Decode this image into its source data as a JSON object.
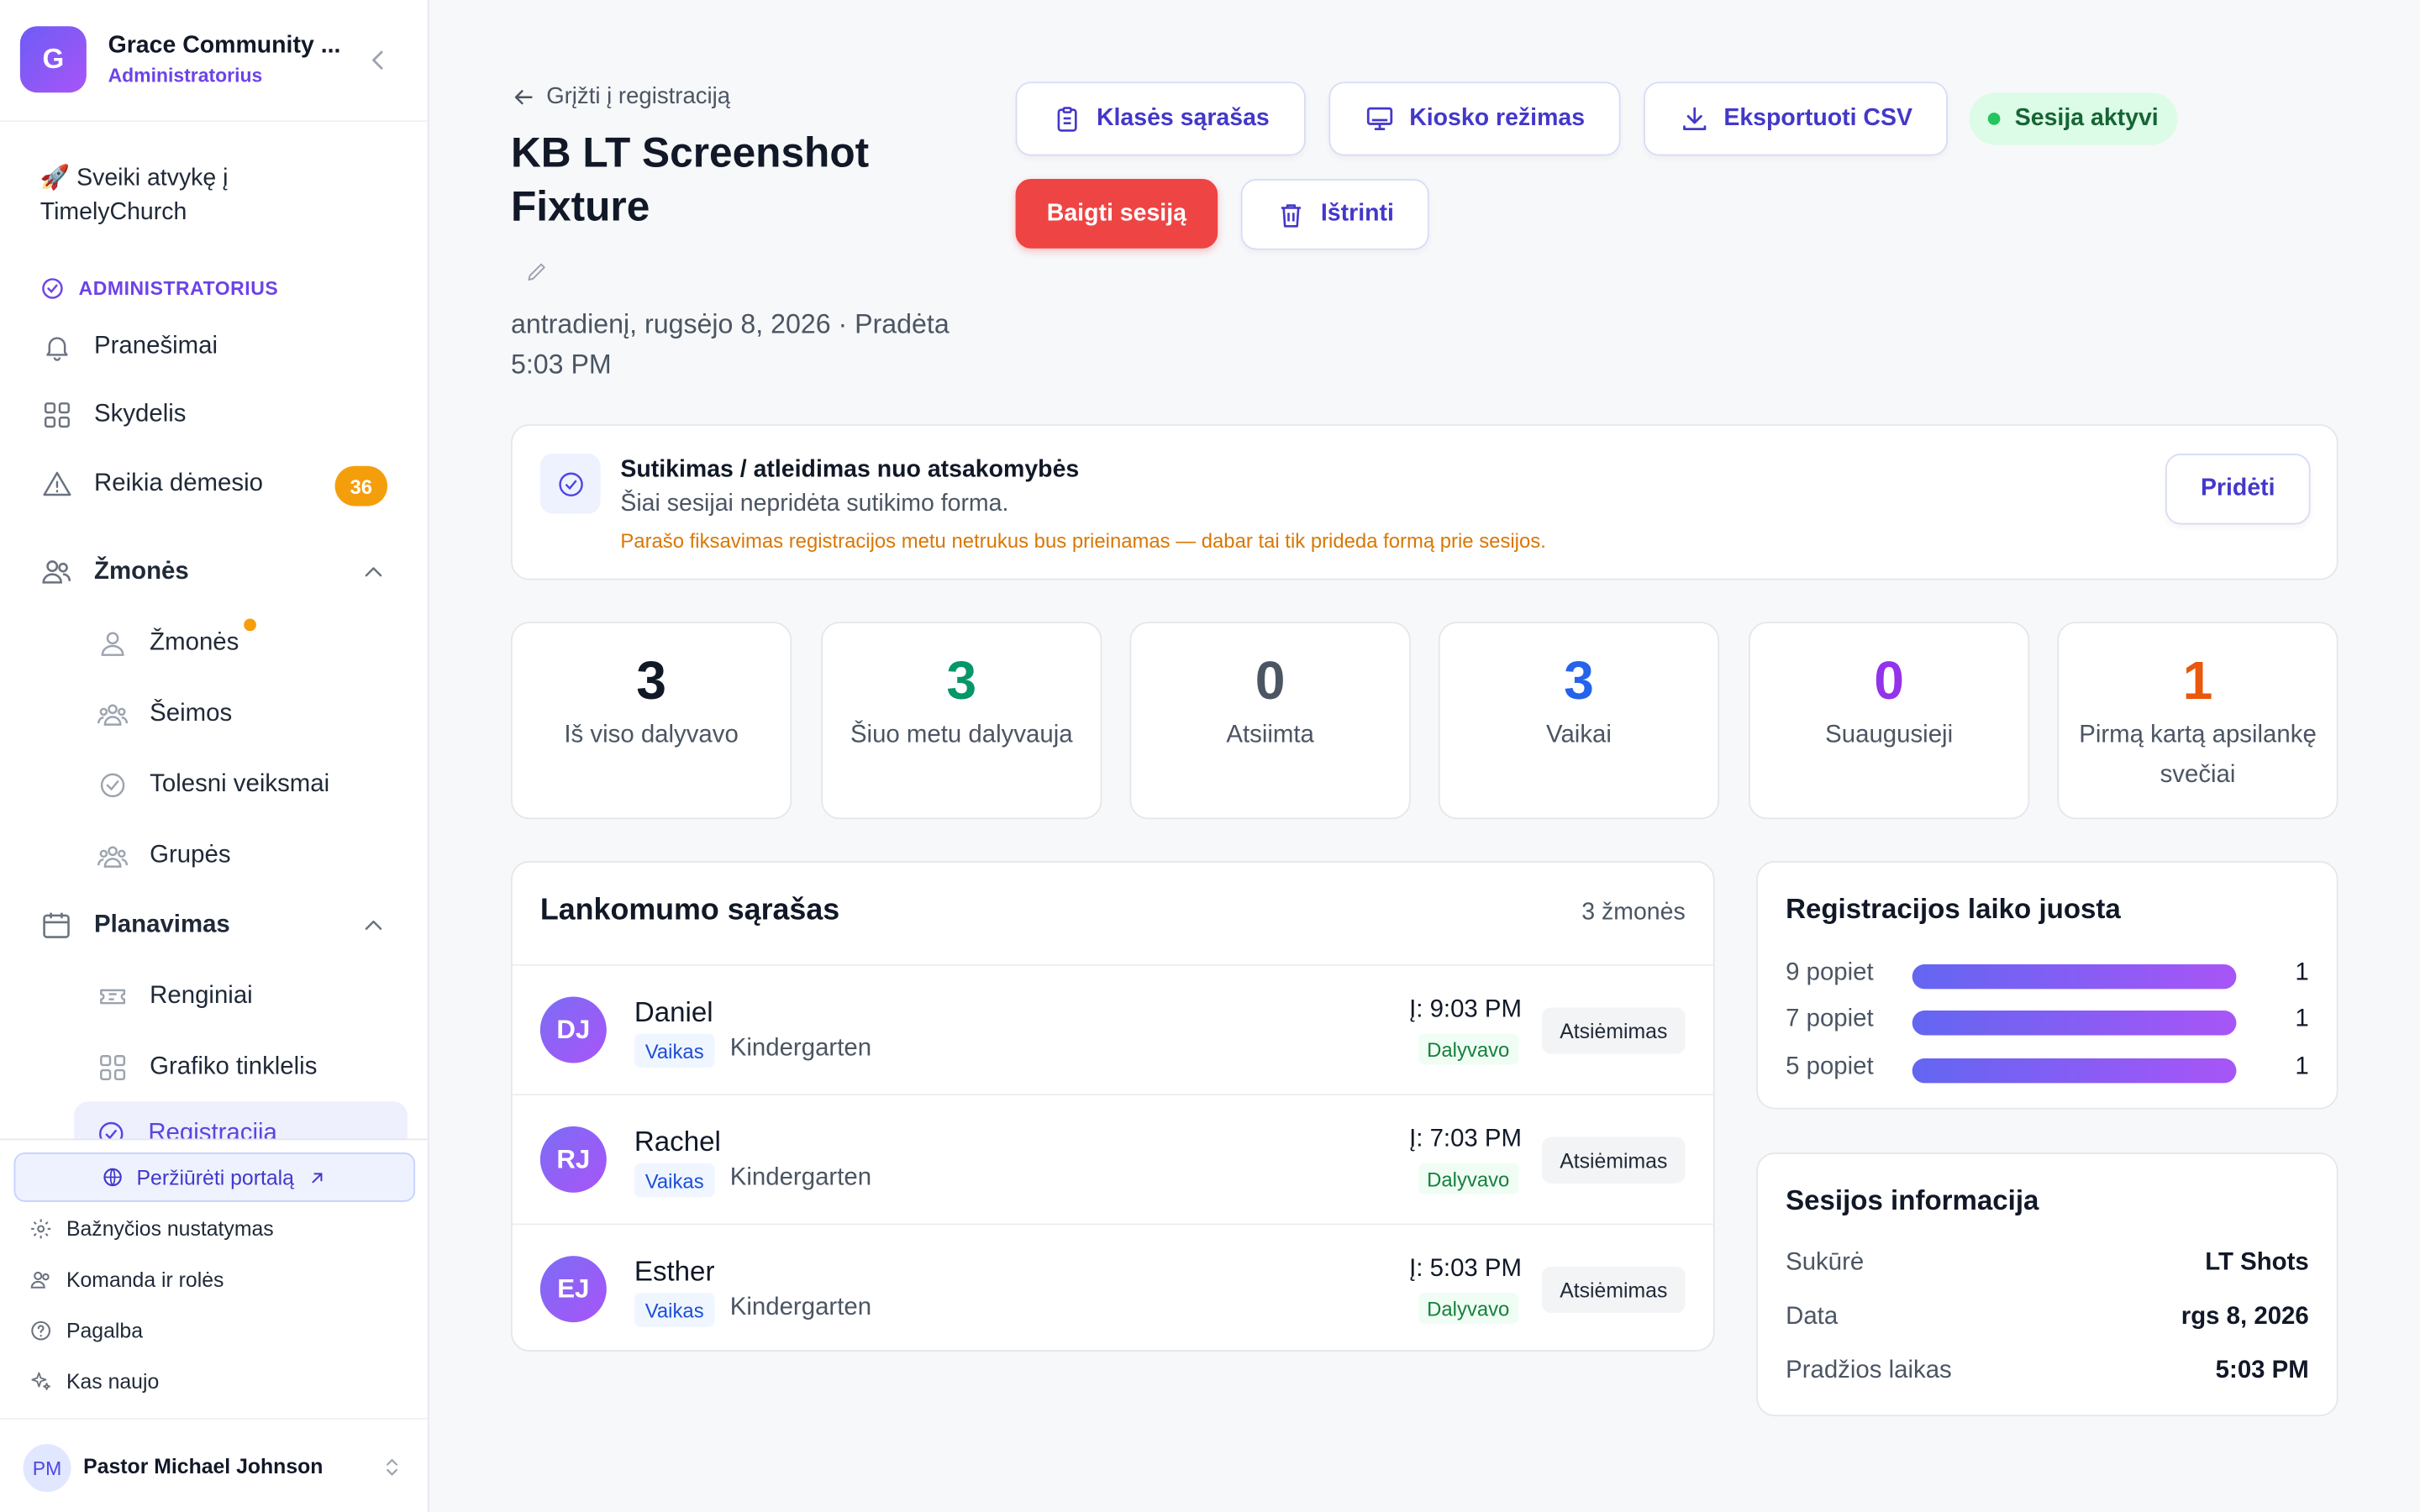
{
  "sidebar": {
    "org_initial": "G",
    "org_name": "Grace Community ...",
    "org_role": "Administratorius",
    "welcome": "🚀 Sveiki atvykę į TimelyChurch",
    "admin_section": "ADMINISTRATORIUS",
    "items": {
      "notifications": "Pranešimai",
      "dashboard": "Skydelis",
      "attention": "Reikia dėmesio",
      "attention_count": "36",
      "people_group": "Žmonės",
      "people": "Žmonės",
      "families": "Šeimos",
      "followups": "Tolesni veiksmai",
      "groups": "Grupės",
      "planning_group": "Planavimas",
      "events": "Renginiai",
      "schedule_grid": "Grafiko tinklelis",
      "checkin": "Registracija"
    },
    "footer": {
      "portal": "Peržiūrėti portalą",
      "church_settings": "Bažnyčios nustatymas",
      "team_roles": "Komanda ir rolės",
      "help": "Pagalba",
      "whats_new": "Kas naujo",
      "user_initials": "PM",
      "user_name": "Pastor Michael Johnson"
    }
  },
  "header": {
    "back": "Grįžti į registraciją",
    "title": "KB LT Screenshot Fixture",
    "subtitle": "antradienį, rugsėjo 8, 2026 · Pradėta 5:03 PM",
    "buttons": {
      "class_list": "Klasės sąrašas",
      "kiosk": "Kiosko režimas",
      "export": "Eksportuoti CSV",
      "end_session": "Baigti sesiją",
      "delete": "Ištrinti"
    },
    "status": "Sesija aktyvi"
  },
  "consent": {
    "title": "Sutikimas / atleidimas nuo atsakomybės",
    "subtitle": "Šiai sesijai nepridėta sutikimo forma.",
    "note": "Parašo fiksavimas registracijos metu netrukus bus prieinamas — dabar tai tik prideda formą prie sesijos.",
    "add": "Pridėti"
  },
  "stats": [
    {
      "value": "3",
      "label": "Iš viso dalyvavo",
      "color": "#111827"
    },
    {
      "value": "3",
      "label": "Šiuo metu dalyvauja",
      "color": "#059669"
    },
    {
      "value": "0",
      "label": "Atsiimta",
      "color": "#4b5563"
    },
    {
      "value": "3",
      "label": "Vaikai",
      "color": "#2563eb"
    },
    {
      "value": "0",
      "label": "Suaugusieji",
      "color": "#9333ea"
    },
    {
      "value": "1",
      "label": "Pirmą kartą apsilankę svečiai",
      "color": "#ea580c"
    }
  ],
  "attendance": {
    "title": "Lankomumo sąrašas",
    "count": "3 žmonės",
    "rows": [
      {
        "initials": "DJ",
        "name": "Daniel",
        "type": "Vaikas",
        "class": "Kindergarten",
        "time": "Į: 9:03 PM",
        "status": "Dalyvavo",
        "action": "Atsiėmimas"
      },
      {
        "initials": "RJ",
        "name": "Rachel",
        "type": "Vaikas",
        "class": "Kindergarten",
        "time": "Į: 7:03 PM",
        "status": "Dalyvavo",
        "action": "Atsiėmimas"
      },
      {
        "initials": "EJ",
        "name": "Esther",
        "type": "Vaikas",
        "class": "Kindergarten",
        "time": "Į: 5:03 PM",
        "status": "Dalyvavo",
        "action": "Atsiėmimas"
      }
    ]
  },
  "timeline": {
    "title": "Registracijos laiko juosta",
    "rows": [
      {
        "time": "9 popiet",
        "count": "1"
      },
      {
        "time": "7 popiet",
        "count": "1"
      },
      {
        "time": "5 popiet",
        "count": "1"
      }
    ]
  },
  "session_info": {
    "title": "Sesijos informacija",
    "rows": [
      {
        "key": "Sukūrė",
        "value": "LT Shots"
      },
      {
        "key": "Data",
        "value": "rgs 8, 2026"
      },
      {
        "key": "Pradžios laikas",
        "value": "5:03 PM"
      }
    ]
  }
}
